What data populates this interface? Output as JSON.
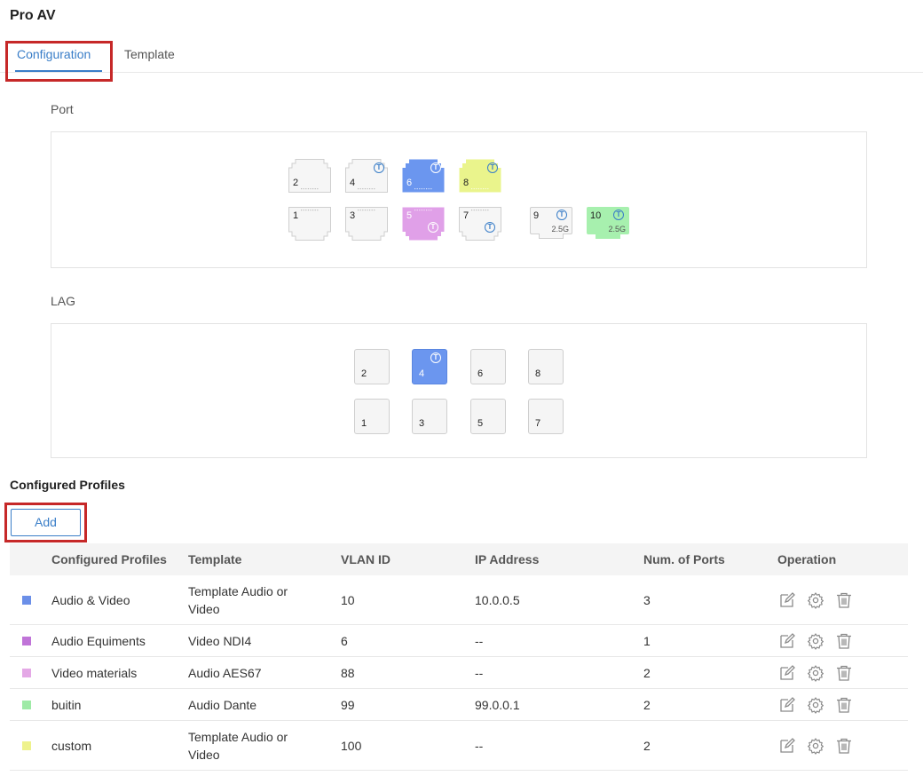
{
  "page": {
    "title": "Pro AV"
  },
  "tabs": [
    {
      "label": "Configuration",
      "active": true
    },
    {
      "label": "Template",
      "active": false
    }
  ],
  "port_section": {
    "label": "Port",
    "ports": [
      {
        "num": "2",
        "color": "",
        "tagged": false
      },
      {
        "num": "4",
        "color": "",
        "tagged": true
      },
      {
        "num": "6",
        "color": "#6b96ef",
        "tagged": true
      },
      {
        "num": "8",
        "color": "#eaf48c",
        "tagged": true
      },
      {
        "num": "1",
        "color": "",
        "tagged": false
      },
      {
        "num": "3",
        "color": "",
        "tagged": false
      },
      {
        "num": "5",
        "color": "#e0a0e8",
        "tagged": true
      },
      {
        "num": "7",
        "color": "",
        "tagged": true
      }
    ],
    "sfp": [
      {
        "num": "9",
        "speed": "2.5G",
        "color": "",
        "tagged": true
      },
      {
        "num": "10",
        "speed": "2.5G",
        "color": "#a7f0ae",
        "tagged": true
      }
    ]
  },
  "lag_section": {
    "label": "LAG",
    "lags": [
      {
        "num": "2",
        "selected": false
      },
      {
        "num": "4",
        "selected": true
      },
      {
        "num": "6",
        "selected": false
      },
      {
        "num": "8",
        "selected": false
      },
      {
        "num": "1",
        "selected": false
      },
      {
        "num": "3",
        "selected": false
      },
      {
        "num": "5",
        "selected": false
      },
      {
        "num": "7",
        "selected": false
      }
    ]
  },
  "profiles": {
    "title": "Configured Profiles",
    "add_label": "Add",
    "columns": [
      "Configured Profiles",
      "Template",
      "VLAN ID",
      "IP Address",
      "Num. of Ports",
      "Operation"
    ],
    "rows": [
      {
        "color": "#6b8fe8",
        "name": "Audio & Video",
        "template": "Template Audio or Video",
        "vlan": "10",
        "ip": "10.0.0.5",
        "ports": "3"
      },
      {
        "color": "#c074d8",
        "name": "Audio Equiments",
        "template": "Video NDI4",
        "vlan": "6",
        "ip": "--",
        "ports": "1"
      },
      {
        "color": "#e4a8e6",
        "name": "Video materials",
        "template": "Audio AES67",
        "vlan": "88",
        "ip": "--",
        "ports": "2"
      },
      {
        "color": "#9eeaa6",
        "name": "buitin",
        "template": "Audio Dante",
        "vlan": "99",
        "ip": "99.0.0.1",
        "ports": "2"
      },
      {
        "color": "#eef28c",
        "name": "custom",
        "template": "Template Audio or Video",
        "vlan": "100",
        "ip": "--",
        "ports": "2"
      }
    ]
  }
}
